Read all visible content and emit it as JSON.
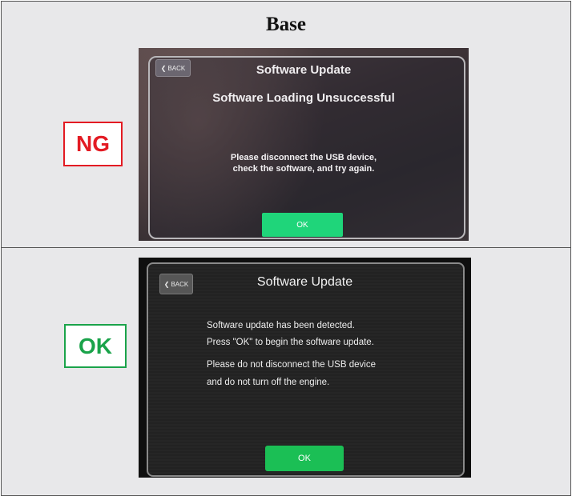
{
  "heading": "Base",
  "ng_label": "NG",
  "ok_label": "OK",
  "ng_screen": {
    "back": "BACK",
    "title": "Software Update",
    "subtitle": "Software Loading Unsuccessful",
    "message_line1": "Please disconnect the USB device,",
    "message_line2": "check the software, and try again.",
    "ok_button": "OK"
  },
  "ok_screen": {
    "back": "BACK",
    "title": "Software Update",
    "line1": "Software update has been detected.",
    "line2": "Press \"OK\" to begin the software update.",
    "line3": "Please do not disconnect the USB device",
    "line4": "and do not turn off the engine.",
    "ok_button": "OK"
  },
  "colors": {
    "ng_red": "#e31b23",
    "ok_green": "#1aa34a",
    "button_green": "#1bbf55"
  }
}
